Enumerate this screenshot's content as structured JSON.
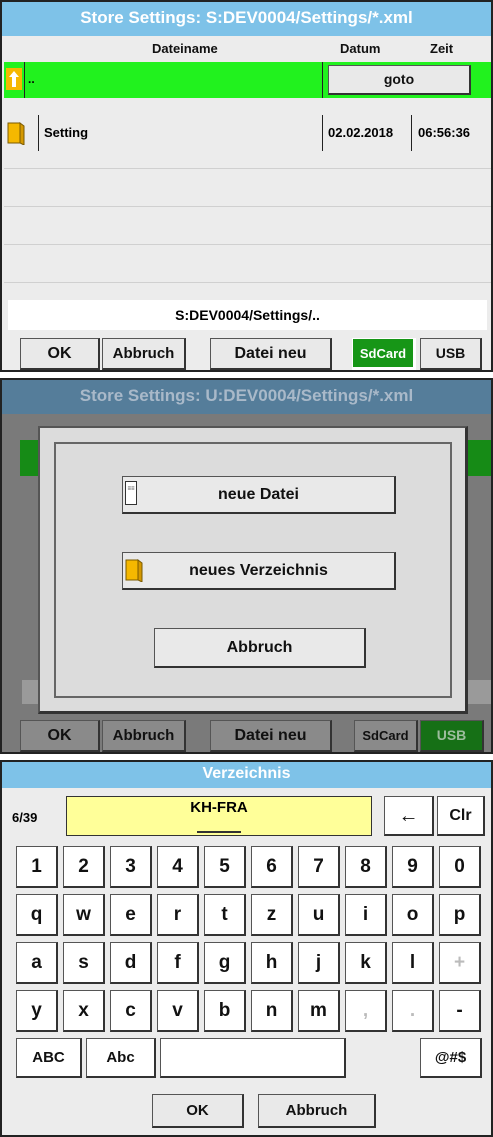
{
  "panel1": {
    "title": "Store Settings:  S:DEV0004/Settings/*.xml",
    "col_filename": "Dateiname",
    "col_date": "Datum",
    "col_time": "Zeit",
    "rows": [
      {
        "name": "..",
        "date": "",
        "time": "",
        "action": "goto",
        "icon": "up-folder-icon",
        "selected": true
      },
      {
        "name": "Setting",
        "date": "02.02.2018",
        "time": "06:56:36",
        "icon": "folder-icon",
        "selected": false
      }
    ],
    "path": "S:DEV0004/Settings/..",
    "buttons": {
      "ok": "OK",
      "cancel": "Abbruch",
      "new_file": "Datei neu",
      "sdcard": "SdCard",
      "usb": "USB"
    },
    "active_storage": "SdCard",
    "colors": {
      "title": "#7ec2e8",
      "selection": "#21f21e",
      "active_button": "#179617"
    }
  },
  "panel2": {
    "title": "Store Settings:  U:DEV0004/Settings/*.xml",
    "buttons": {
      "ok": "OK",
      "cancel": "Abbruch",
      "new_file": "Datei neu",
      "sdcard": "SdCard",
      "usb": "USB"
    },
    "active_storage": "USB",
    "dialog": {
      "new_file": "neue Datei",
      "new_folder": "neues Verzeichnis",
      "cancel": "Abbruch"
    }
  },
  "panel3": {
    "title": "Verzeichnis",
    "counter": "6/39",
    "input_value": "KH-FRA",
    "backspace": "←",
    "clear": "Clr",
    "keys_row1": [
      "1",
      "2",
      "3",
      "4",
      "5",
      "6",
      "7",
      "8",
      "9",
      "0"
    ],
    "keys_row2": [
      "q",
      "w",
      "e",
      "r",
      "t",
      "z",
      "u",
      "i",
      "o",
      "p"
    ],
    "keys_row3": [
      "a",
      "s",
      "d",
      "f",
      "g",
      "h",
      "j",
      "k",
      "l",
      "+"
    ],
    "keys_row4": [
      "y",
      "x",
      "c",
      "v",
      "b",
      "n",
      "m",
      ",",
      ".",
      "-"
    ],
    "mode_upper": "ABC",
    "mode_cap": "Abc",
    "mode_symbols": "@#$",
    "ok": "OK",
    "cancel": "Abbruch",
    "colors": {
      "input": "#ffff99",
      "title": "#7ec2e8"
    }
  }
}
